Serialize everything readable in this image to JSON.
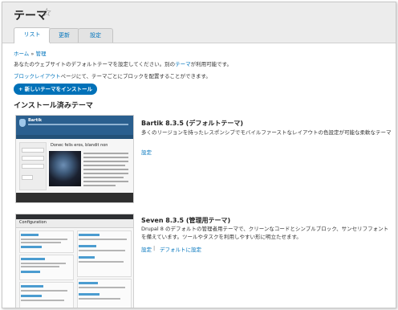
{
  "page": {
    "title": "テーマ"
  },
  "tabs": [
    {
      "label": "リスト",
      "active": true
    },
    {
      "label": "更新",
      "active": false
    },
    {
      "label": "設定",
      "active": false
    }
  ],
  "breadcrumb": {
    "home": "ホーム",
    "separator": "»",
    "admin": "管理"
  },
  "intro": {
    "line1_before": "あなたのウェブサイトのデフォルトテーマを設定してください。別の",
    "line1_link": "テーマ",
    "line1_after": "が利用可能です。",
    "line2_link": "ブロックレイアウト",
    "line2_after": "ページにて、テーマごとにブロックを配置することができます。"
  },
  "install_button": "+ 新しいテーマをインストール",
  "section_heading": "インストール済みテーマ",
  "themes": [
    {
      "title": "Bartik 8.3.5 (デフォルトテーマ)",
      "description": "多くのリージョンを持ったレスポンシブでモバイルファーストなレイアウトの色設定が可能な柔軟なテーマ",
      "links": [
        "設定"
      ],
      "preview": {
        "site_name": "Bartik",
        "content_title": "Donec felis eros, blandit non"
      }
    },
    {
      "title": "Seven 8.3.5 (管理用テーマ)",
      "description": "Drupal 8 のデフォルトの管理者用テーマで、クリーンなコードとシンプルブロック、サンセリフフォントを備えています。ツールやタスクを利用しやすい形に明立たせます。",
      "links": [
        "設定",
        "デフォルトに設定"
      ],
      "link_separator": "|",
      "preview": {
        "heading": "Configuration"
      }
    }
  ],
  "colors": {
    "link": "#0074bd",
    "button": "#0071b8",
    "header_bg": "#ececec"
  }
}
